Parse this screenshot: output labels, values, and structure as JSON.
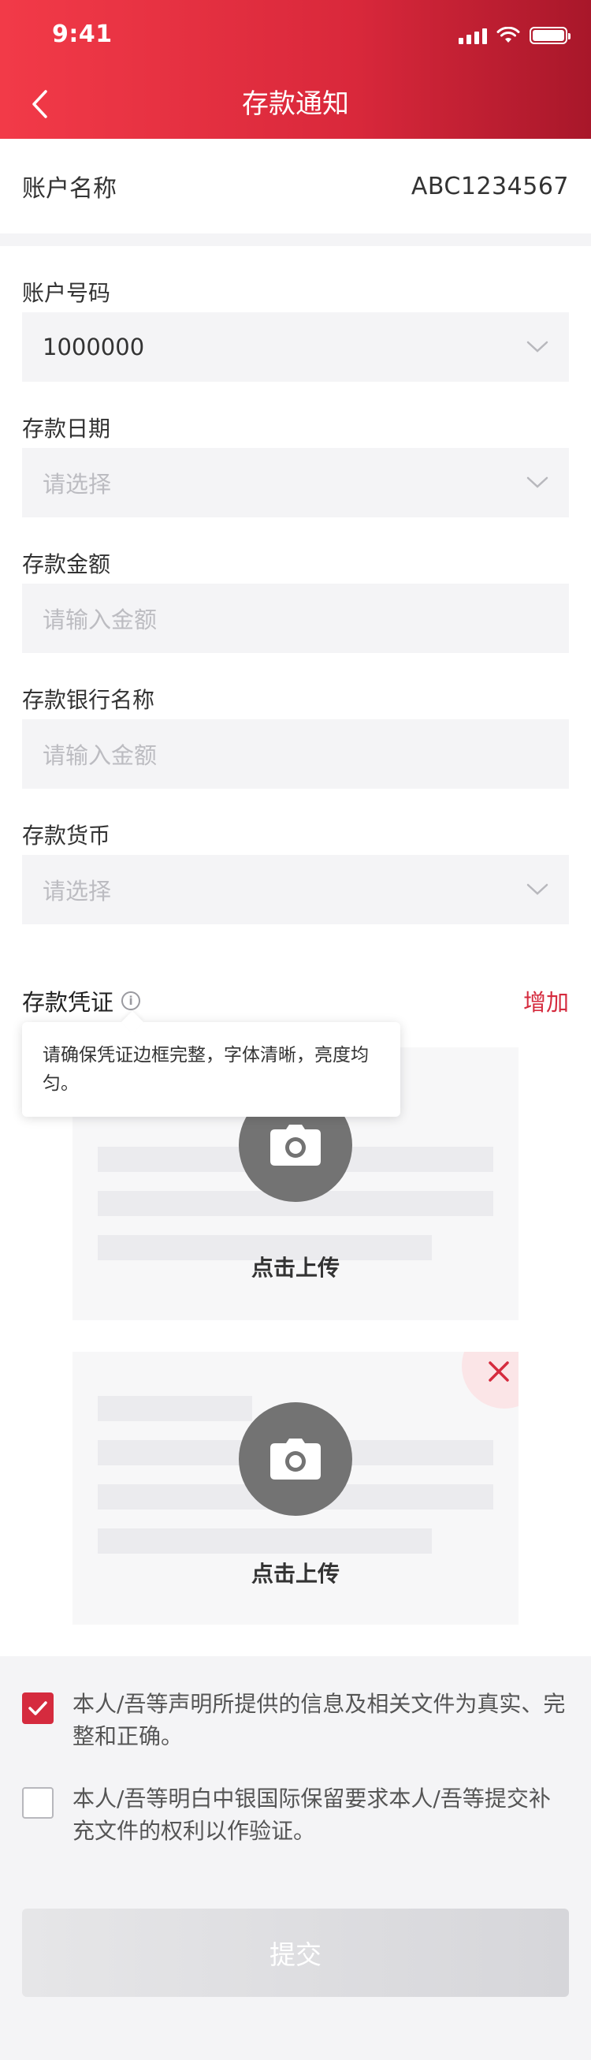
{
  "status_bar": {
    "time": "9:41"
  },
  "header": {
    "title": "存款通知",
    "back_icon": "chevron-left-icon"
  },
  "account_name": {
    "label": "账户名称",
    "value": "ABC1234567"
  },
  "form": {
    "account_number": {
      "label": "账户号码",
      "value": "1000000"
    },
    "deposit_date": {
      "label": "存款日期",
      "placeholder": "请选择"
    },
    "deposit_amount": {
      "label": "存款金额",
      "placeholder": "请输入金额"
    },
    "deposit_bank": {
      "label": "存款银行名称",
      "placeholder": "请输入金额"
    },
    "deposit_currency": {
      "label": "存款货币",
      "placeholder": "请选择"
    }
  },
  "voucher": {
    "label": "存款凭证",
    "add_label": "增加",
    "tooltip": "请确保凭证边框完整，字体清晰，亮度均匀。",
    "uploads": [
      {
        "label": "点击上传"
      },
      {
        "label": "点击上传"
      }
    ]
  },
  "agreements": [
    {
      "checked": true,
      "text": "本人/吾等声明所提供的信息及相关文件为真实、完整和正确。"
    },
    {
      "checked": false,
      "text": "本人/吾等明白中银国际保留要求本人/吾等提交补充文件的权利以作验证。"
    }
  ],
  "submit": {
    "label": "提交"
  },
  "colors": {
    "brand": "#d52b3e",
    "header_start": "#f23a48",
    "header_end": "#a8172a"
  }
}
